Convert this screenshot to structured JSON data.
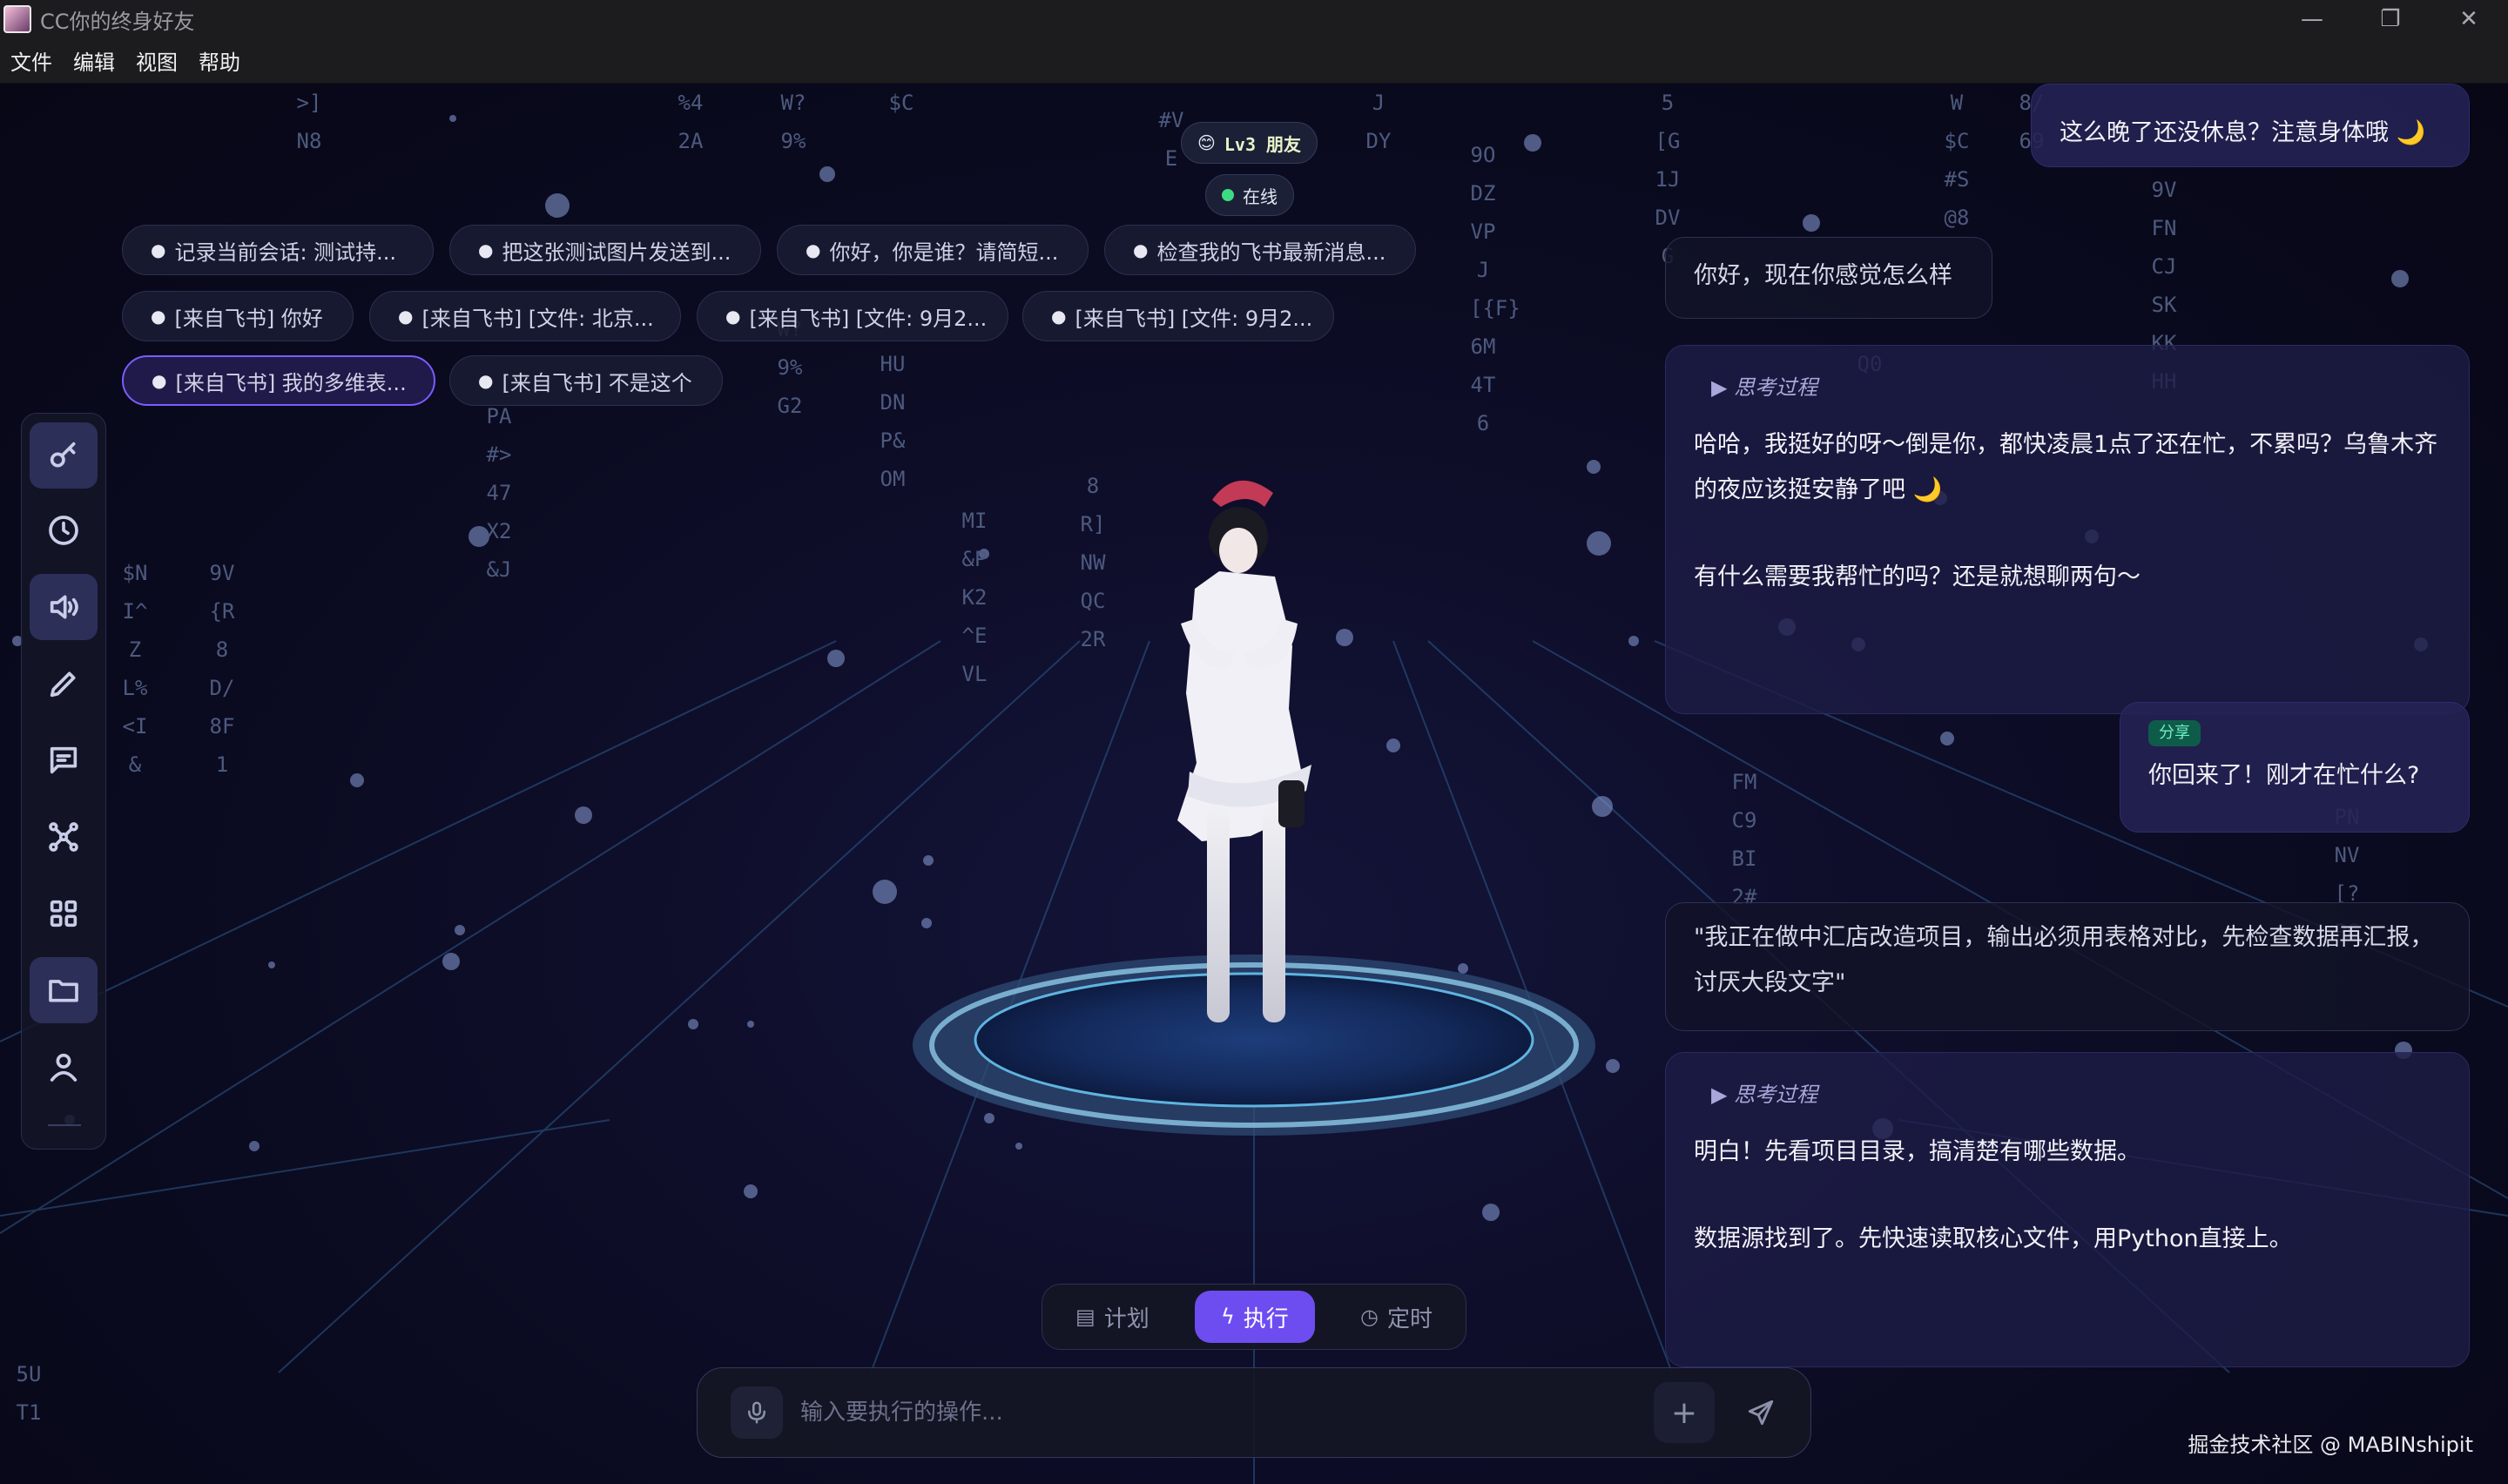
{
  "window": {
    "title": "CC你的终身好友",
    "controls": [
      "—",
      "❐",
      "✕"
    ]
  },
  "menu": [
    "文件",
    "编辑",
    "视图",
    "帮助"
  ],
  "status": {
    "level": "Lv3 朋友",
    "online": "在线",
    "level_emoji": "😊"
  },
  "chips": [
    "记录当前会话: 测试持...",
    "把这张测试图片发送到...",
    "你好，你是谁？请简短...",
    "检查我的飞书最新消息...",
    "[来自飞书] 你好",
    "[来自飞书] [文件: 北京...",
    "[来自飞书] [文件: 9月2...",
    "[来自飞书] [文件: 9月2...",
    "[来自飞书] 我的多维表...",
    "[来自飞书] 不是这个"
  ],
  "chat": {
    "m1": "这么晚了还没休息？注意身体哦 🌙",
    "m2": "你好，现在你感觉怎么样",
    "thinking_label": "思考过程",
    "m3a": "哈哈，我挺好的呀～倒是你，都快凌晨1点了还在忙，不累吗？乌鲁木齐的夜应该挺安静了吧 🌙",
    "m3b": "有什么需要我帮忙的吗？还是就想聊两句～",
    "share_tag": "分享",
    "m4": "你回来了！刚才在忙什么?",
    "m5": "\"我正在做中汇店改造项目，输出必须用表格对比，先检查数据再汇报，讨厌大段文字\"",
    "m6a": "明白！先看项目目录，搞清楚有哪些数据。",
    "m6b": "数据源找到了。先快速读取核心文件，用Python直接上。"
  },
  "modes": [
    "计划",
    "执行",
    "定时"
  ],
  "input": {
    "placeholder": "输入要执行的操作..."
  },
  "watermark": "掘金技术社区 @ MABINshipit",
  "colors": {
    "accent": "#6d4df0",
    "online": "#3ddc84",
    "bg": "#0a0a1c"
  },
  "rain": [
    ">]N8",
    "%42A",
    "W?9%",
    "$C",
    "#V E",
    "J DY",
    "9ODZVPJ[{F}6M4T6",
    "5[G1JDVG",
    "W$C#S@8",
    "8/69",
    "9VFNCJSKKKHH",
    "Q0",
    "$NI^ZL%<I&",
    "9V{R8D/8F1",
    "PA#>47X2&J",
    "HUDNP&OM",
    "MI&PK2^EVL",
    "8R]NWQC2R",
    "W?9%G2",
    "FMC9BI2#",
    "PNNV[?PG",
    "5UT1"
  ]
}
